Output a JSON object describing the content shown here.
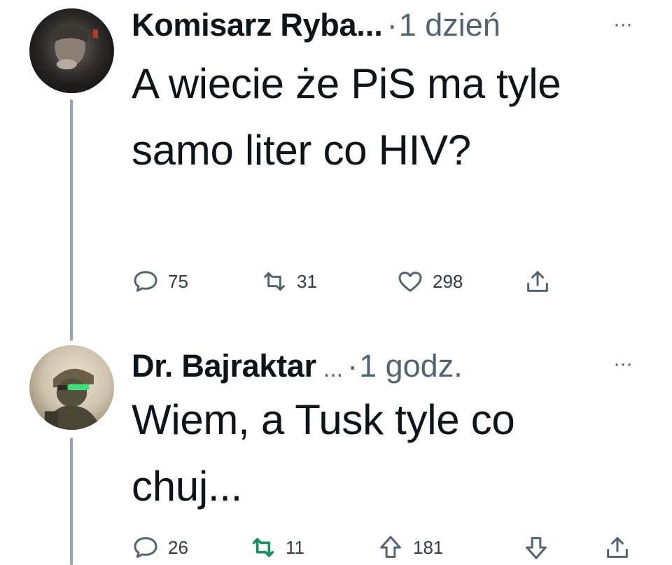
{
  "tweets": [
    {
      "author": {
        "name": "Komisarz Ryba",
        "name_ellipsis": "...",
        "dot": "·",
        "time": "1 dzień",
        "more": "···"
      },
      "text": "A wiecie że PiS ma tyle samo liter co HIV?",
      "actions": {
        "reply_count": "75",
        "retweet_count": "31",
        "like_count": "298"
      }
    },
    {
      "author": {
        "name": "Dr. Bajraktar",
        "name_ellipsis": "...",
        "dot": "·",
        "time": "1 godz.",
        "more": "···"
      },
      "text": "Wiem, a Tusk tyle co chuj...",
      "actions": {
        "reply_count": "26",
        "retweet_count": "11",
        "upvote_count": "181"
      }
    }
  ],
  "colors": {
    "text": "#0f1419",
    "muted": "#536471",
    "thread_line": "#9aa3ab",
    "retweet_active": "#17915e"
  },
  "icons": {
    "reply": "speech-bubble-icon",
    "retweet": "retweet-arrows-icon",
    "like": "heart-icon",
    "share": "share-upload-icon",
    "upvote": "up-arrow-icon",
    "downvote": "down-arrow-icon"
  }
}
